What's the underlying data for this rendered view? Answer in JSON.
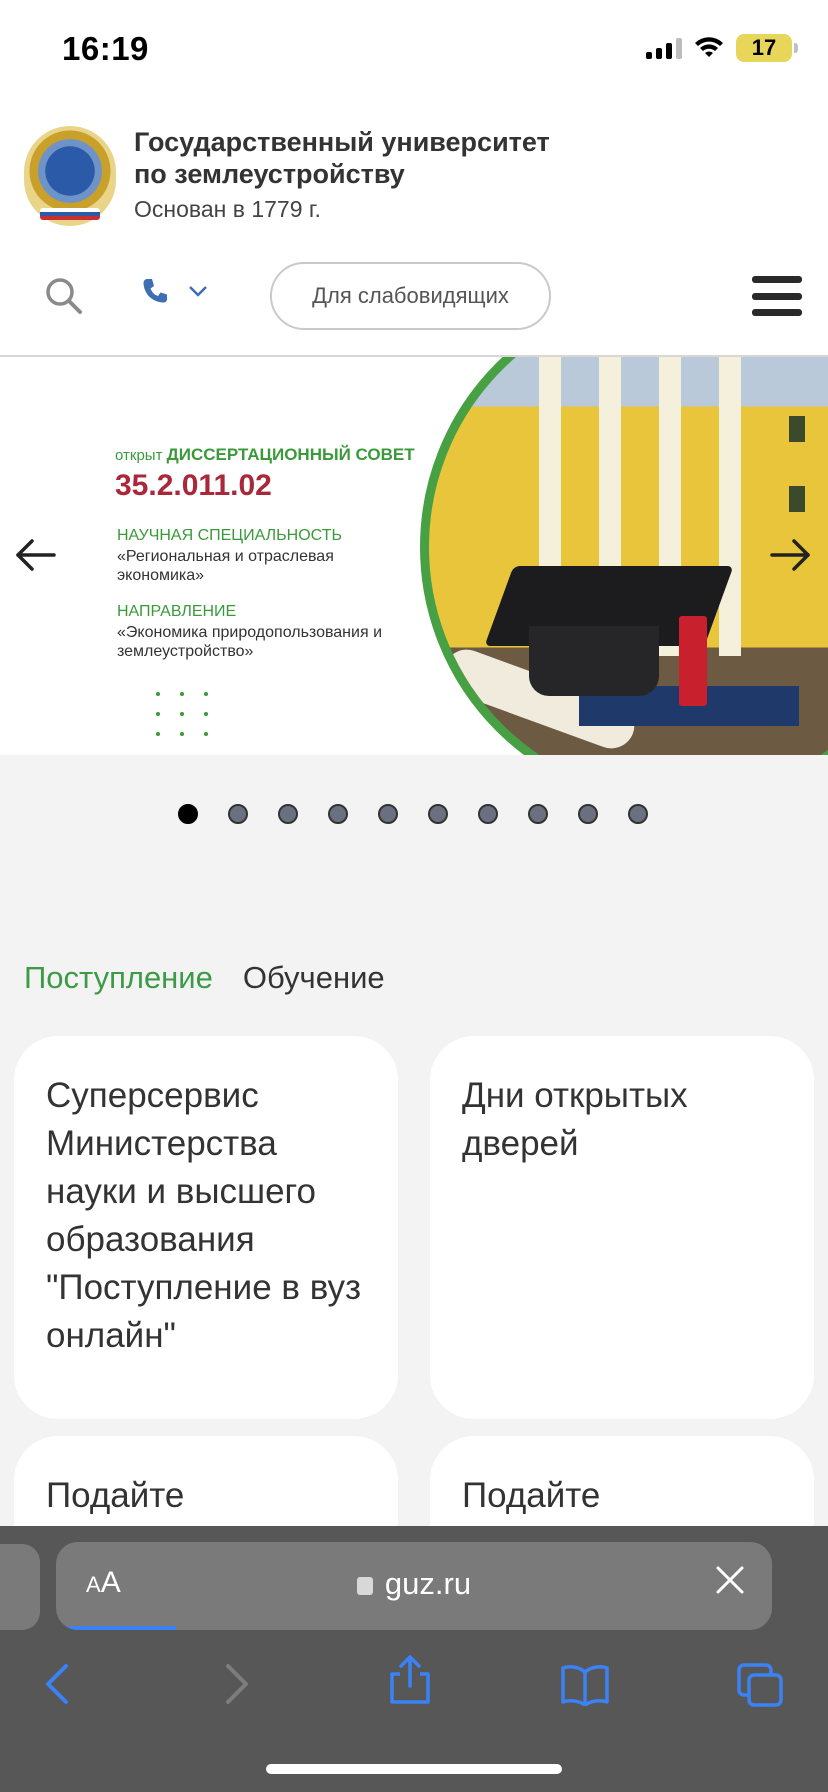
{
  "status_bar": {
    "time": "16:19",
    "battery": "17"
  },
  "header": {
    "title_line1": "Государственный университет",
    "title_line2": "по землеустройству",
    "subtitle": "Основан в 1779 г.",
    "low_vision_label": "Для слабовидящих"
  },
  "banner": {
    "open_prefix": "открыт",
    "open_title": "ДИССЕРТАЦИОННЫЙ СОВЕТ",
    "number": "35.2.011.02",
    "spec_title": "НАУЧНАЯ СПЕЦИАЛЬНОСТЬ",
    "spec_text": "«Региональная и отраслевая экономика»",
    "dir_title": "НАПРАВЛЕНИЕ",
    "dir_text": "«Экономика природопользования и землеустройство»"
  },
  "pager": {
    "count": 10,
    "active_index": 0
  },
  "tabs": [
    {
      "label": "Поступление",
      "active": true
    },
    {
      "label": "Обучение",
      "active": false
    }
  ],
  "cards": [
    {
      "text": "Суперсервис Министерства науки и высшего образования \"Поступление в вуз онлайн\""
    },
    {
      "text": "Дни открытых дверей"
    },
    {
      "text": "Подайте"
    },
    {
      "text": "Подайте"
    }
  ],
  "safari": {
    "aa_label": "AA",
    "url": "guz.ru"
  },
  "colors": {
    "accent_green": "#3d9a47",
    "banner_red": "#a9283a",
    "safari_bar": "#575757",
    "link_blue": "#3b82f6"
  },
  "icons": [
    "search-icon",
    "phone-icon",
    "chevron-down-icon",
    "hamburger-menu-icon",
    "arrow-left-icon",
    "arrow-right-icon",
    "lock-icon",
    "close-icon",
    "back-icon",
    "forward-icon",
    "share-icon",
    "bookmarks-icon",
    "tabs-icon"
  ]
}
